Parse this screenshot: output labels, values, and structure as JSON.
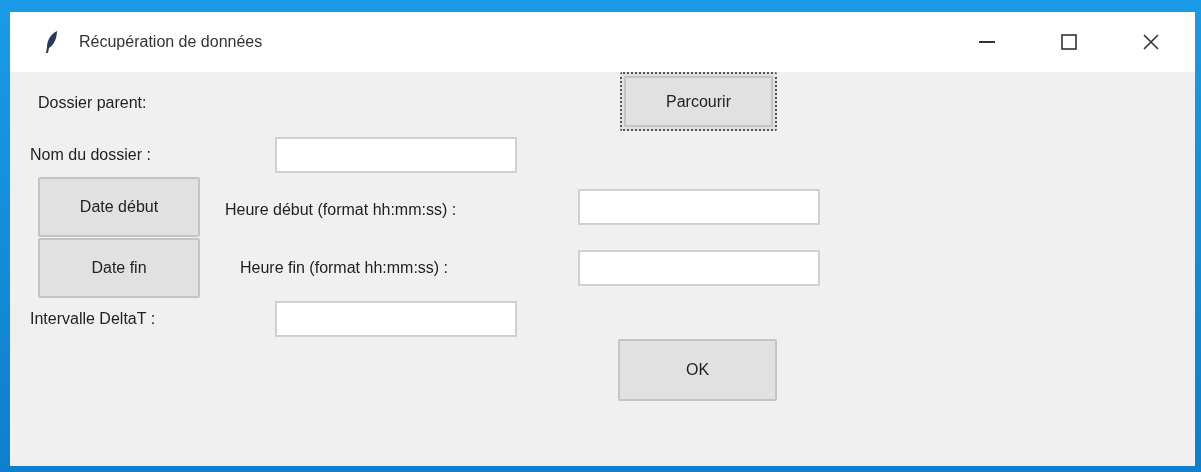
{
  "window": {
    "title": "Récupération de données"
  },
  "parent_folder": {
    "label": "Dossier parent:",
    "browse_button": {
      "label": "Parcourir",
      "focused": true
    }
  },
  "folder_name": {
    "label": "Nom du dossier :"
  },
  "start": {
    "button": "Date début",
    "label": "Heure début (format hh:mm:ss) :"
  },
  "end": {
    "button": "Date fin",
    "label": "Heure fin (format hh:mm:ss) :"
  },
  "interval": {
    "label": "Intervalle DeltaT :"
  },
  "ok_button": "OK"
}
